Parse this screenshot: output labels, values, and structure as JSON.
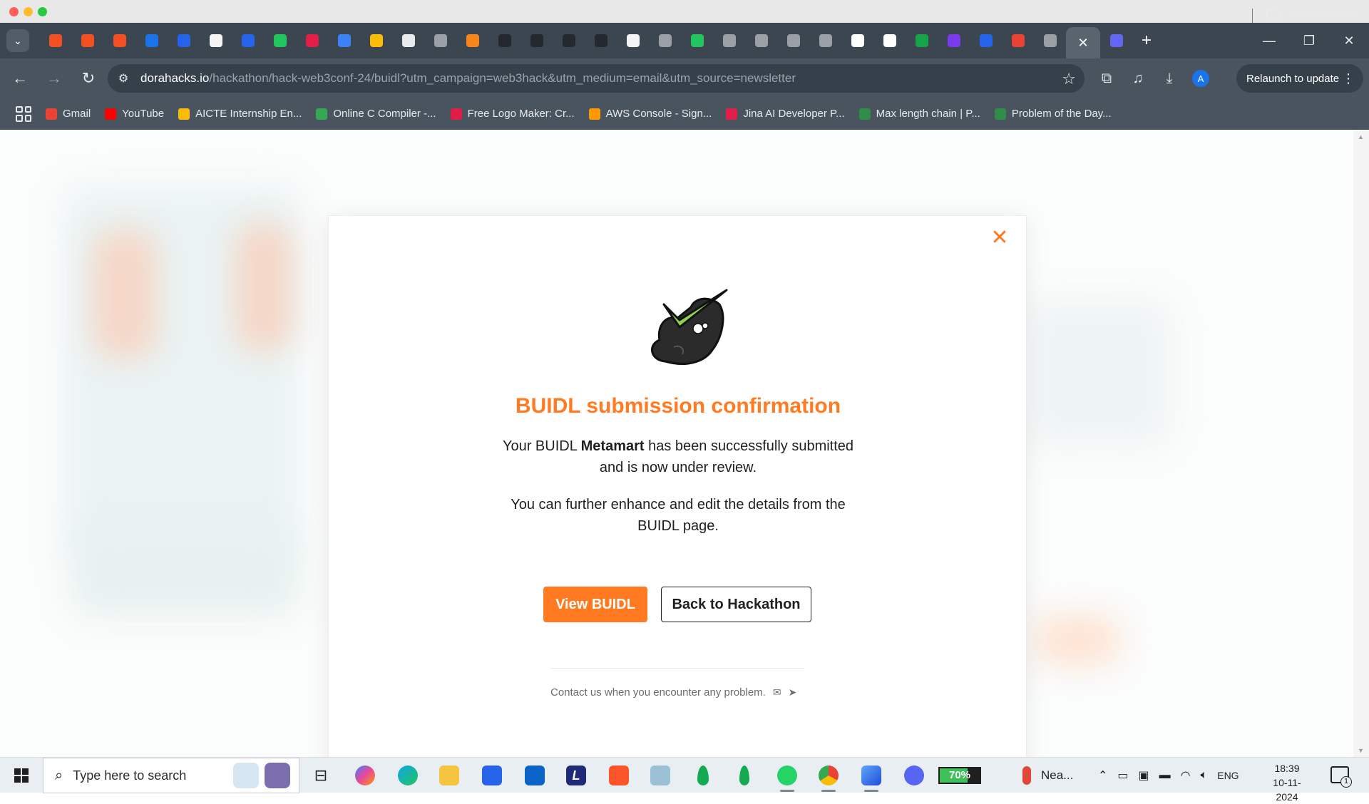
{
  "browser": {
    "url_host": "dorahacks.io",
    "url_path": "/hackathon/hack-web3conf-24/buidl?utm_campaign=web3hack&utm_medium=email&utm_source=newsletter",
    "relaunch_label": "Relaunch to update",
    "profile_initial": "A",
    "tab_favicon_colors": [
      "#f25022",
      "#f25022",
      "#f25022",
      "#1a73e8",
      "#2563eb",
      "#f4f4f4",
      "#2563eb",
      "#22c55e",
      "#e11d48",
      "#3b82f6",
      "#fbbc05",
      "#e8eaed",
      "#9aa0a6",
      "#f6851b",
      "#24292f",
      "#24292f",
      "#24292f",
      "#24292f",
      "#f4f4f4",
      "#9aa0a6",
      "#22c55e",
      "#9aa0a6",
      "#9aa0a6",
      "#9aa0a6",
      "#9aa0a6",
      "#ffffff",
      "#ffffff",
      "#16a34a",
      "#7c3aed",
      "#2563eb",
      "#ea4335",
      "#9aa0a6",
      "#6366f1"
    ],
    "bookmarks": [
      {
        "label": "Gmail",
        "color": "#ea4335"
      },
      {
        "label": "YouTube",
        "color": "#ff0000"
      },
      {
        "label": "AICTE Internship En...",
        "color": "#fbbc05"
      },
      {
        "label": "Online C Compiler -...",
        "color": "#34a853"
      },
      {
        "label": "Free Logo Maker: Cr...",
        "color": "#e11d48"
      },
      {
        "label": "AWS Console - Sign...",
        "color": "#ff9900"
      },
      {
        "label": "Jina AI Developer P...",
        "color": "#e11d48"
      },
      {
        "label": "Max length chain | P...",
        "color": "#2f8d46"
      },
      {
        "label": "Problem of the Day...",
        "color": "#2f8d46"
      }
    ],
    "all_bookmarks_label": "All Bookmarks"
  },
  "modal": {
    "title": "BUIDL submission confirmation",
    "message_prefix": "Your BUIDL ",
    "project_name": "Metamart",
    "message_suffix": " has been successfully submitted and is now under review.",
    "message2": "You can further enhance and edit the details from the BUIDL page.",
    "primary_button": "View BUIDL",
    "secondary_button": "Back to Hackathon",
    "contact_text": "Contact us when you encounter any problem.",
    "accent_color": "#ff7a21"
  },
  "taskbar": {
    "search_placeholder": "Type here to search",
    "battery_percent": "70%",
    "battery_level": 0.7,
    "weather_label": "Nea...",
    "language": "ENG",
    "time": "18:39",
    "date": "10-11-2024",
    "notification_count": "1"
  }
}
